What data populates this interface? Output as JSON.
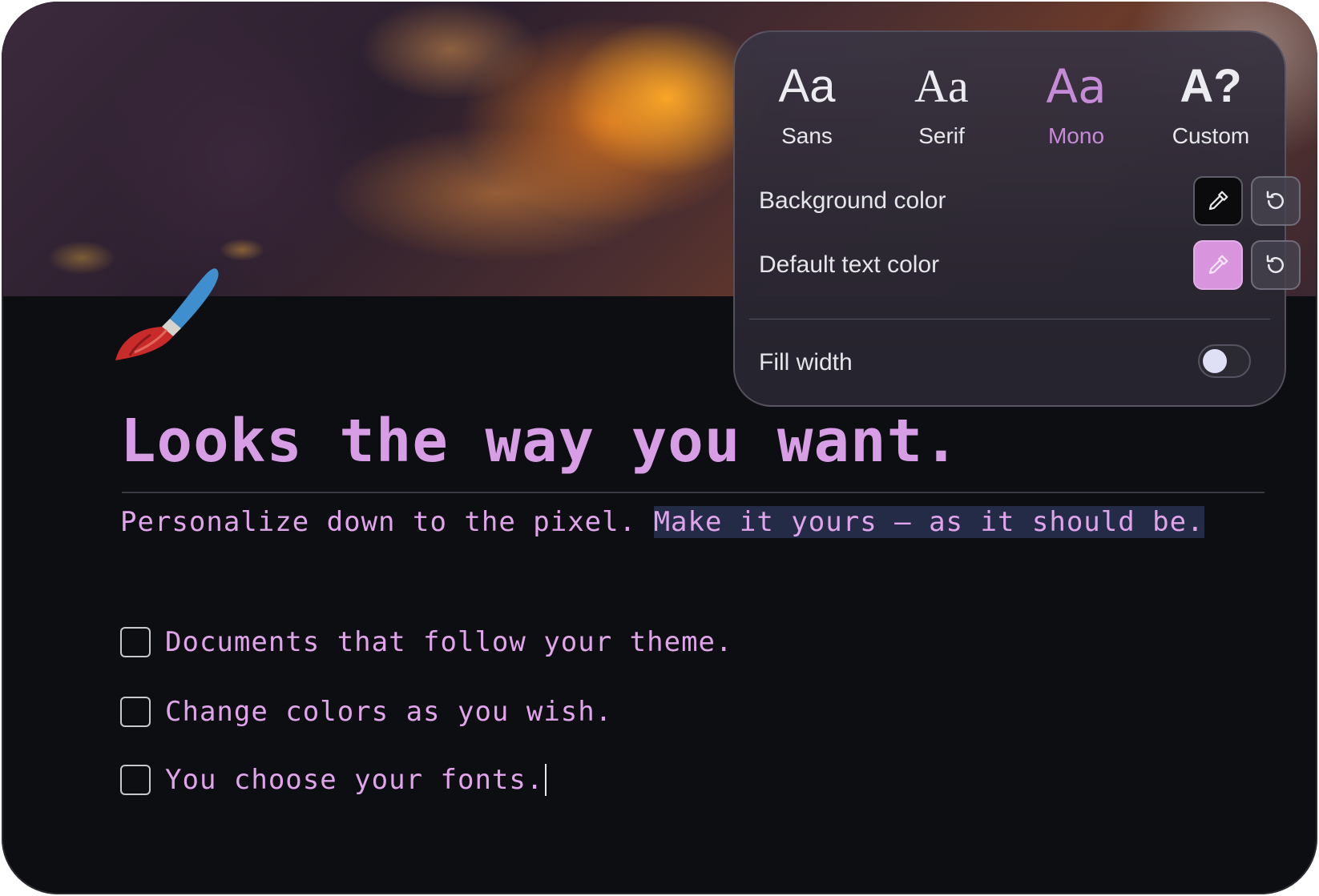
{
  "font_picker": {
    "options": [
      {
        "glyph": "Aa",
        "label": "Sans"
      },
      {
        "glyph": "Aa",
        "label": "Serif"
      },
      {
        "glyph": "Aa",
        "label": "Mono"
      },
      {
        "glyph": "A?",
        "label": "Custom"
      }
    ],
    "selected": "Mono"
  },
  "settings": {
    "background_color_label": "Background color",
    "text_color_label": "Default text color",
    "fill_width_label": "Fill width",
    "fill_width_on": false,
    "text_color_value": "#d894dd",
    "background_color_value": "#0b0b0e"
  },
  "document": {
    "title": "Looks the way you want.",
    "subtitle_plain": "Personalize down to the pixel. ",
    "subtitle_highlight": "Make it yours – as it should be.",
    "todos": [
      "Documents that follow your theme.",
      "Change colors as you wish.",
      "You choose your fonts."
    ]
  },
  "colors": {
    "accent": "#d79ee6",
    "highlight_bg": "#232b47",
    "page_bg": "#0d0e12"
  }
}
